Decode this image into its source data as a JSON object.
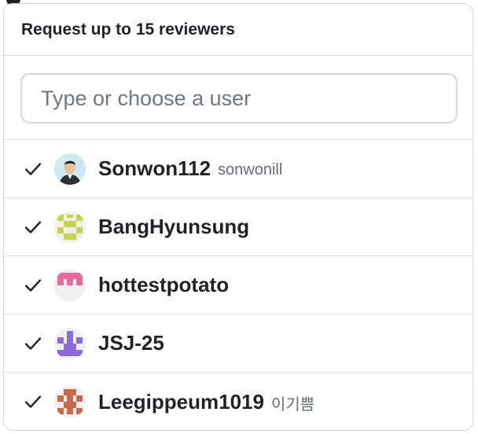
{
  "header": {
    "title": "Request up to 15 reviewers"
  },
  "search": {
    "placeholder": "Type or choose a user",
    "value": ""
  },
  "reviewers": [
    {
      "login": "Sonwon112",
      "name": "sonwonill",
      "selected": true,
      "avatar": "photo"
    },
    {
      "login": "BangHyunsung",
      "name": "",
      "selected": true,
      "avatar": "identicon-lime"
    },
    {
      "login": "hottestpotato",
      "name": "",
      "selected": true,
      "avatar": "identicon-pink"
    },
    {
      "login": "JSJ-25",
      "name": "",
      "selected": true,
      "avatar": "identicon-purple"
    },
    {
      "login": "Leegippeum1019",
      "name": "이기쁨",
      "selected": true,
      "avatar": "identicon-orange"
    }
  ],
  "colors": {
    "lime": "#c8d449",
    "pink": "#e56aa2",
    "purple": "#8b6ad9",
    "orange": "#c9684b",
    "text": "#1f2328",
    "muted": "#656d76",
    "border": "#d0d7de"
  }
}
